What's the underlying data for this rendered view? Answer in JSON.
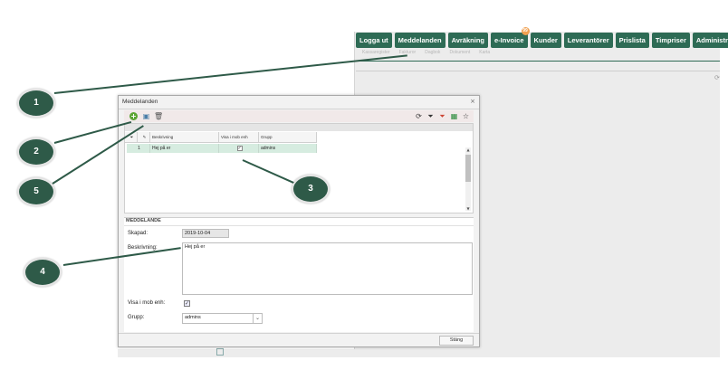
{
  "topnav": [
    {
      "label": "Logga ut"
    },
    {
      "label": "Meddelanden"
    },
    {
      "label": "Avräkning"
    },
    {
      "label": "e-Invoice",
      "badge": "99"
    },
    {
      "label": "Kunder"
    },
    {
      "label": "Leverantörer"
    },
    {
      "label": "Prislista"
    },
    {
      "label": "Timpriser"
    },
    {
      "label": "Administration"
    }
  ],
  "subnav": [
    "Kassaregister",
    "Fakturor",
    "Dagbok",
    "Dokument",
    "Karta"
  ],
  "dialog": {
    "title": "Meddelanden",
    "close_glyph": "×",
    "toolbar": {
      "add_icon": "plus-icon",
      "save_icon": "save-icon",
      "delete_icon": "trash-icon",
      "right_icons": [
        "refresh-icon",
        "filter-icon",
        "clear-filter-icon",
        "excel-export-icon",
        "star-icon"
      ]
    },
    "grid": {
      "columns": [
        "Beskrivning",
        "Visa i mob enh",
        "Grupp"
      ],
      "rows": [
        {
          "num": "1",
          "beskrivning": "Hej på er",
          "visa": true,
          "grupp": "admins"
        }
      ]
    },
    "form": {
      "section_title": "MEDDELANDE",
      "skapad_label": "Skapad:",
      "skapad_value": "2019-10-04",
      "beskrivning_label": "Beskrivning:",
      "beskrivning_value": "Hej på er",
      "visa_label": "Visa i mob enh:",
      "visa_checked": true,
      "grupp_label": "Grupp:",
      "grupp_value": "admins"
    },
    "close_button": "Stäng"
  },
  "callouts": [
    "1",
    "2",
    "3",
    "4",
    "5"
  ],
  "colors": {
    "nav_green": "#2e6b55",
    "callout": "#2e5a48",
    "row_selected": "#d6ece0"
  }
}
